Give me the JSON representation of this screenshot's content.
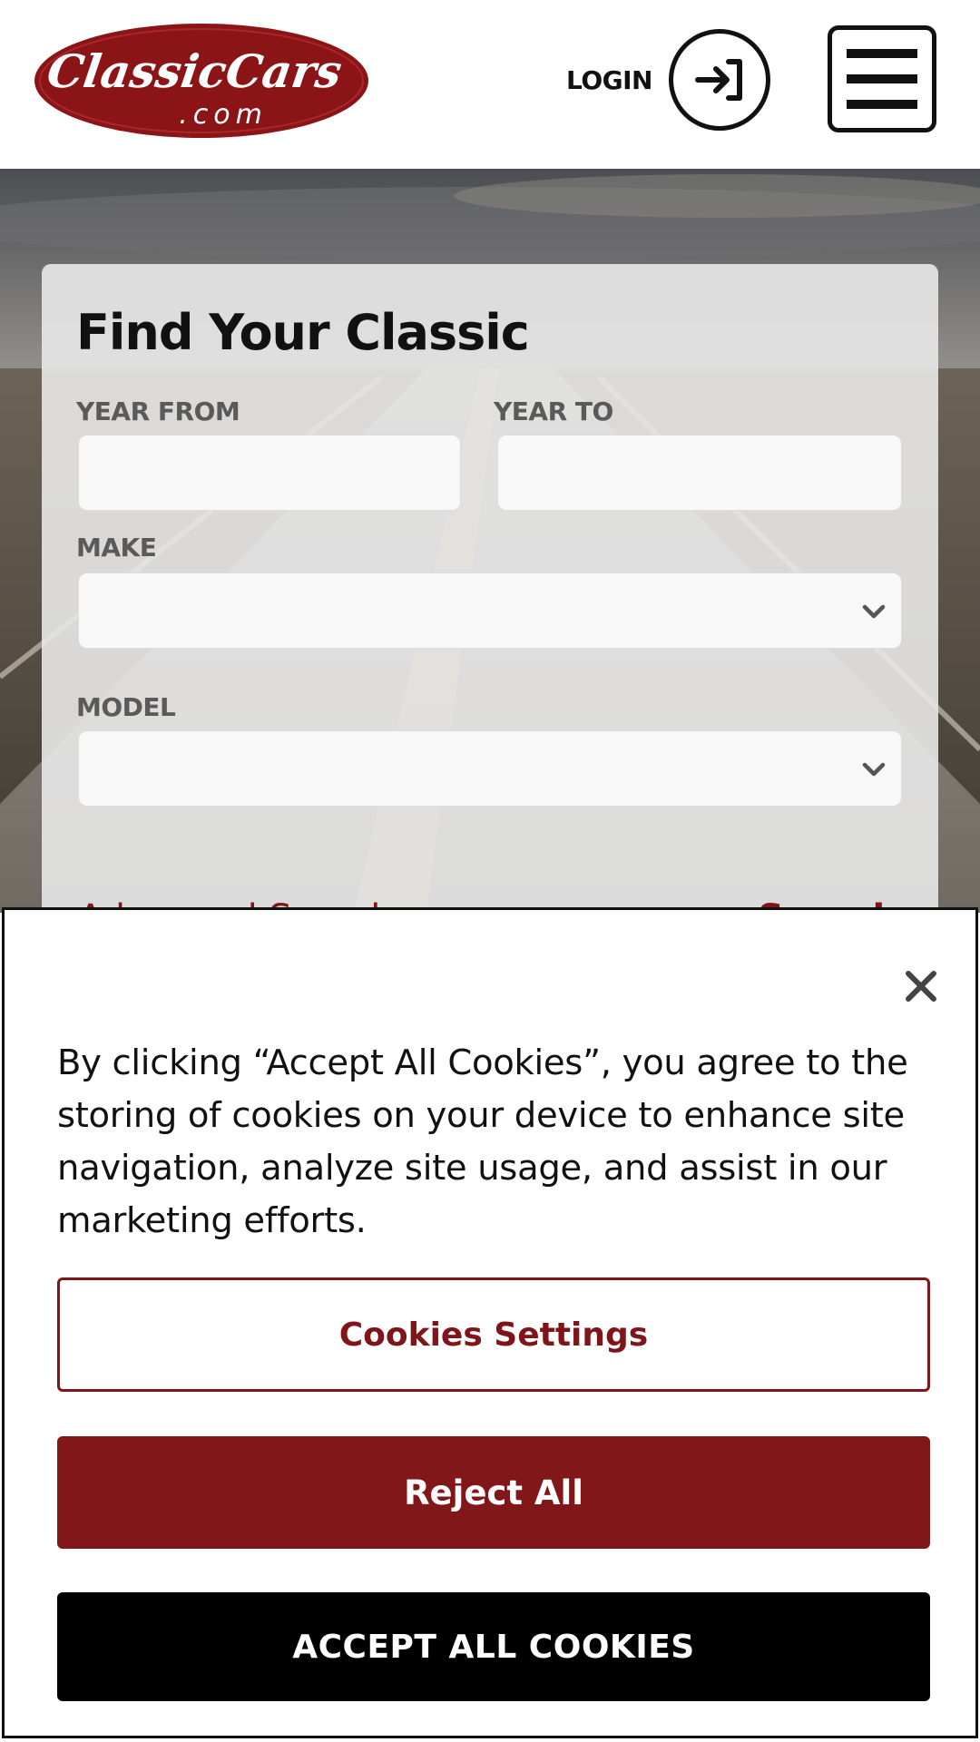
{
  "header": {
    "logo_main": "ClassicCars",
    "logo_sub": ".com",
    "login_label": "LOGIN",
    "login_icon": "sign-in-icon",
    "menu_icon": "hamburger-menu-icon",
    "brand_color": "#8b1416"
  },
  "search": {
    "title": "Find Your Classic",
    "year_from_label": "YEAR FROM",
    "year_from_value": "",
    "year_to_label": "YEAR TO",
    "year_to_value": "",
    "make_label": "MAKE",
    "make_value": "",
    "model_label": "MODEL",
    "model_value": "",
    "advanced_link": "Advanced Search",
    "search_link": "Search"
  },
  "cookie_banner": {
    "text": "By clicking “Accept All Cookies”, you agree to the storing of cookies on your device to enhance site navigation, analyze site usage, and assist in our marketing efforts.",
    "settings_label": "Cookies Settings",
    "reject_label": "Reject All",
    "accept_label": "ACCEPT ALL COOKIES",
    "close_icon": "close-icon",
    "accent_color": "#82171a"
  }
}
